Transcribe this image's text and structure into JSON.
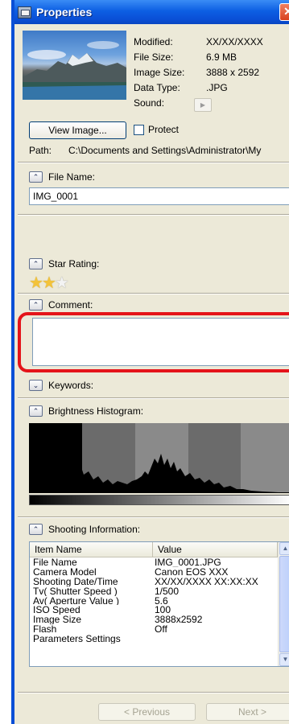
{
  "window": {
    "title": "Properties",
    "close_label": "✕"
  },
  "thumbnail": {
    "icon_name": "photo-thumbnail"
  },
  "file_info": {
    "labels": [
      "Modified:",
      "File Size:",
      "Image Size:",
      "Data Type:",
      "Sound:"
    ],
    "modified": "XX/XX/XXXX",
    "file_size": "6.9 MB",
    "image_size": "3888 x 2592",
    "data_type": ".JPG",
    "sound_play_glyph": "▶"
  },
  "actions": {
    "view_image_label": "View Image...",
    "protect_label": "Protect",
    "protect_checked": false
  },
  "path": {
    "label": "Path:",
    "value": "C:\\Documents and Settings\\Administrator\\My"
  },
  "sections": {
    "file_name": {
      "label": "File Name:",
      "value": "IMG_0001"
    },
    "star_rating": {
      "label": "Star Rating:",
      "rating": 2,
      "max": 3
    },
    "comment": {
      "label": "Comment:",
      "value": ""
    },
    "keywords": {
      "label": "Keywords:"
    },
    "histogram": {
      "label": "Brightness Histogram:"
    },
    "shooting": {
      "label": "Shooting Information:"
    }
  },
  "shooting_table": {
    "headers": [
      "Item Name",
      "Value"
    ],
    "rows": [
      [
        "File Name",
        "IMG_0001.JPG"
      ],
      [
        "Camera Model",
        "Canon EOS XXX"
      ],
      [
        "Shooting Date/Time",
        "XX/XX/XXXX XX:XX:XX"
      ],
      [
        "Tv( Shutter Speed )",
        "1/500"
      ],
      [
        "Av( Aperture Value )",
        "5.6"
      ],
      [
        "ISO Speed",
        "100"
      ],
      [
        "Image Size",
        "3888x2592"
      ],
      [
        "Flash",
        "Off"
      ],
      [
        "Parameters Settings",
        ""
      ]
    ]
  },
  "navigation": {
    "previous_label": "< Previous",
    "next_label": "Next >"
  },
  "colors": {
    "title_bar": "#0a4fd6",
    "highlight_ring": "#e4141a",
    "star": "#f3c33a"
  }
}
